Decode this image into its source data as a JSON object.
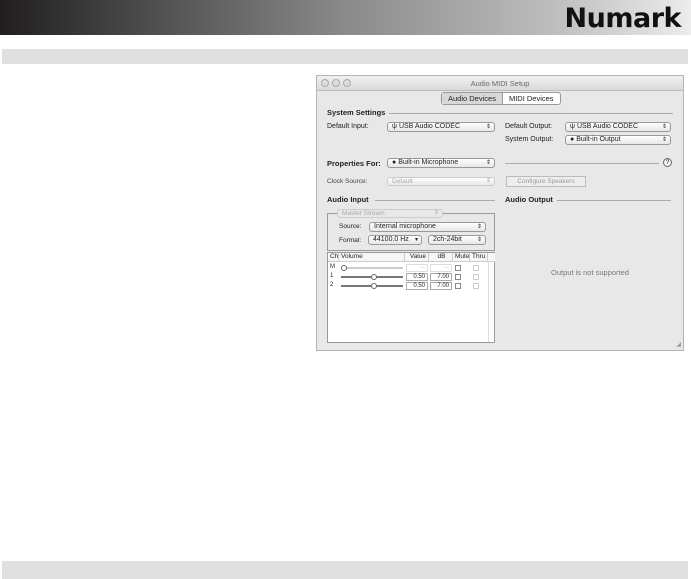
{
  "header": {
    "logo": "Numark"
  },
  "window": {
    "title": "Audio MIDI Setup",
    "tabs": [
      {
        "label": "Audio Devices",
        "selected": true
      },
      {
        "label": "MIDI Devices",
        "selected": false
      }
    ],
    "system_settings": {
      "heading": "System Settings",
      "default_input_label": "Default Input:",
      "default_input": "USB Audio CODEC",
      "default_output_label": "Default Output:",
      "default_output": "USB Audio CODEC",
      "system_output_label": "System Output:",
      "system_output": "Built-in Output"
    },
    "properties_for_label": "Properties For:",
    "properties_for": "Built-in Microphone",
    "help": "?",
    "clock_source_label": "Clock Source:",
    "clock_source": "Default",
    "configure_speakers": "Configure Speakers",
    "audio_input": {
      "heading": "Audio Input",
      "stream": "Master Stream",
      "source_label": "Source:",
      "source": "Internal microphone",
      "format_label": "Format:",
      "rate": "44100.0 Hz",
      "bits": "2ch-24bit",
      "columns": [
        "Ch",
        "Volume",
        "Value",
        "dB",
        "Mute",
        "Thru"
      ],
      "rows": [
        {
          "ch": "M",
          "level": 0,
          "value": "--",
          "db": "--"
        },
        {
          "ch": "1",
          "level": 0.5,
          "value": "0.50",
          "db": "7.00"
        },
        {
          "ch": "2",
          "level": 0.5,
          "value": "0.50",
          "db": "7.00"
        }
      ]
    },
    "audio_output": {
      "heading": "Audio Output",
      "message": "Output is not supported"
    }
  }
}
